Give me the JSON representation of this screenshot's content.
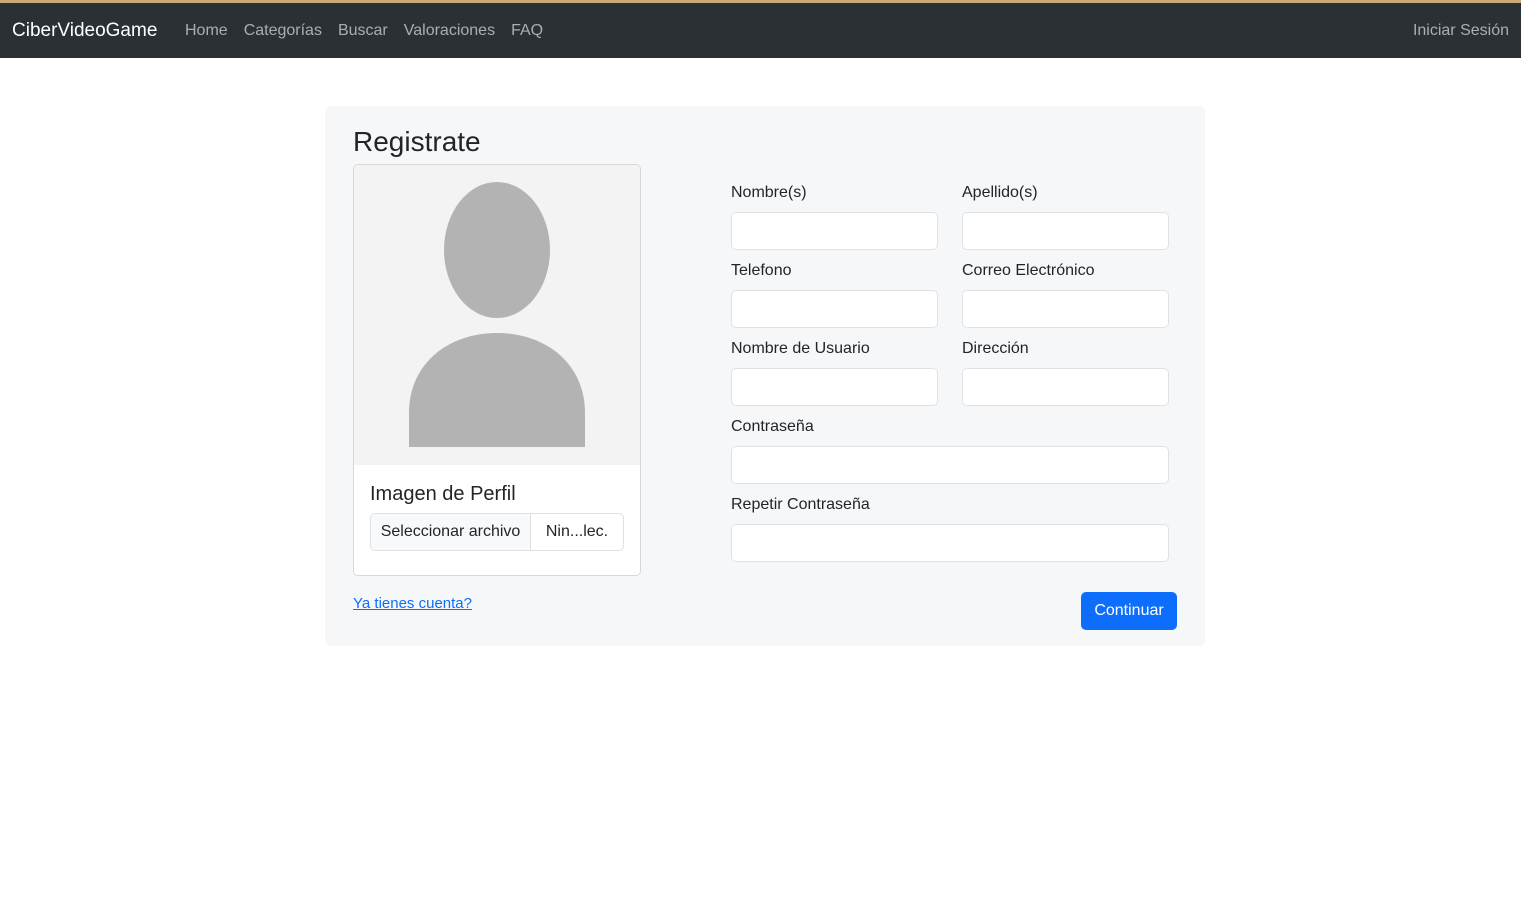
{
  "navbar": {
    "brand": "CiberVideoGame",
    "links": [
      "Home",
      "Categorías",
      "Buscar",
      "Valoraciones",
      "FAQ"
    ],
    "login": "Iniciar Sesión"
  },
  "form": {
    "title": "Registrate",
    "profile_card": {
      "title": "Imagen de Perfil",
      "file_button": "Seleccionar archivo",
      "file_status": "Nin...lec.",
      "image_icon": "person-silhouette-icon"
    },
    "fields": {
      "nombre": {
        "label": "Nombre(s)",
        "value": ""
      },
      "apellido": {
        "label": "Apellido(s)",
        "value": ""
      },
      "telefono": {
        "label": "Telefono",
        "value": ""
      },
      "correo": {
        "label": "Correo Electrónico",
        "value": ""
      },
      "usuario": {
        "label": "Nombre de Usuario",
        "value": ""
      },
      "direccion": {
        "label": "Dirección",
        "value": ""
      },
      "contrasena": {
        "label": "Contraseña",
        "value": ""
      },
      "repetir": {
        "label": "Repetir Contraseña",
        "value": ""
      }
    },
    "account_link": "Ya tienes cuenta?",
    "continue": "Continuar"
  },
  "colors": {
    "navbar_bg": "#2b3035",
    "primary": "#0d6efd",
    "panel_bg": "#f6f7f8",
    "silhouette": "#b3b3b3"
  }
}
